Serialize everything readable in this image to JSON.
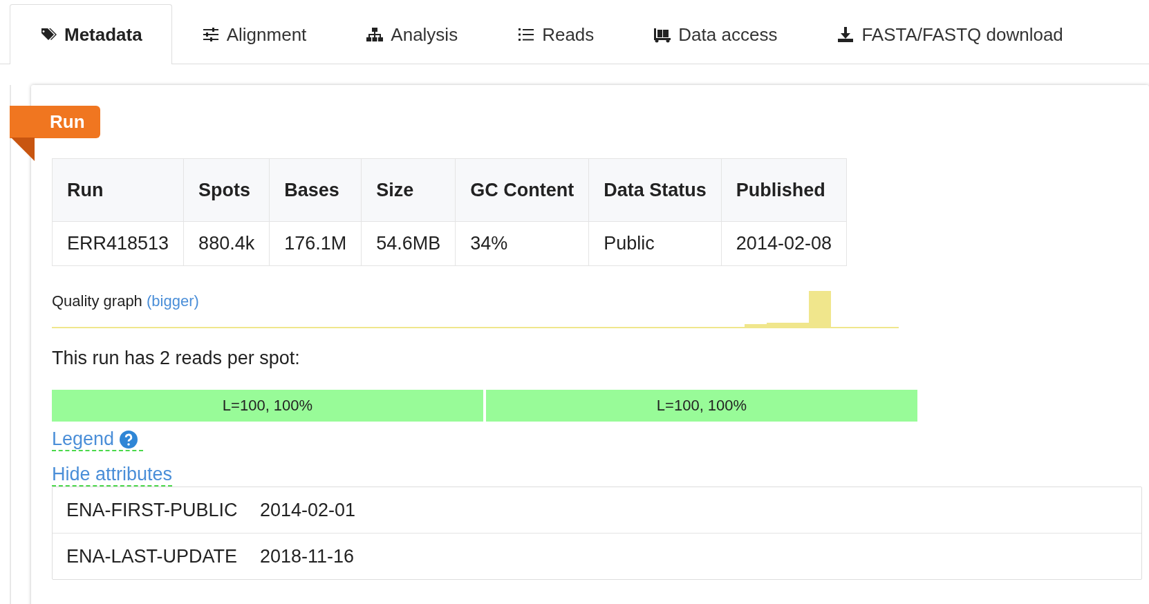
{
  "tabs": [
    {
      "label": "Metadata",
      "selected": true
    },
    {
      "label": "Alignment",
      "selected": false
    },
    {
      "label": "Analysis",
      "selected": false
    },
    {
      "label": "Reads",
      "selected": false
    },
    {
      "label": "Data access",
      "selected": false
    },
    {
      "label": "FASTA/FASTQ download",
      "selected": false
    }
  ],
  "section": {
    "ribbon": "Run",
    "table": {
      "columns": [
        "Run",
        "Spots",
        "Bases",
        "Size",
        "GC Content",
        "Data Status",
        "Published"
      ],
      "rows": [
        [
          "ERR418513",
          "880.4k",
          "176.1M",
          "54.6MB",
          "34%",
          "Public",
          "2014-02-08"
        ]
      ]
    },
    "quality_graph": {
      "label": "Quality graph",
      "link": "(bigger)"
    },
    "reads_text": "This run has 2 reads per spot:",
    "reads": [
      {
        "label": "L=100, 100%"
      },
      {
        "label": "L=100, 100%"
      }
    ],
    "legend_link": "Legend",
    "attributes_link": "Hide attributes",
    "attributes": [
      {
        "name": "ENA-FIRST-PUBLIC",
        "value": "2014-02-01"
      },
      {
        "name": "ENA-LAST-UPDATE",
        "value": "2018-11-16"
      }
    ]
  }
}
